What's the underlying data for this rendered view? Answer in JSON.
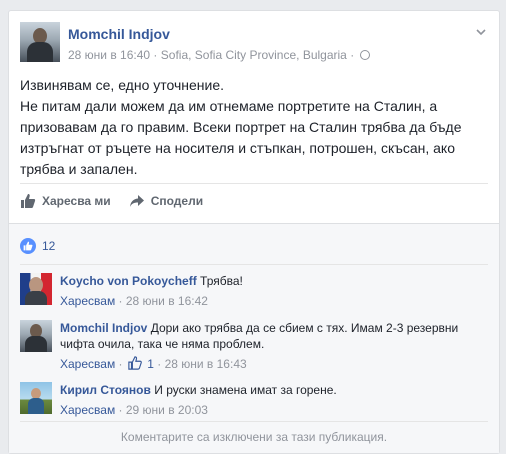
{
  "post": {
    "author": "Momchil Indjov",
    "date": "28 юни в 16:40",
    "location": "Sofia, Sofia City Province, Bulgaria",
    "text_lines": [
      "Извинявам се, едно уточнение.",
      "Не питам дали можем да им отнемаме портретите на Сталин, а",
      "призовавам да го правим. Всеки портрет на Сталин трябва да бъде",
      "изтръгнат от ръцете на носителя и стъпкан, потрошен, скъсан, ако",
      "трябва и запален."
    ]
  },
  "actions": {
    "like": "Харесва ми",
    "share": "Сподели"
  },
  "likes_count": "12",
  "comments": [
    {
      "author": "Koycho von Pokoycheff",
      "text": "Трябва!",
      "like_label": "Харесвам",
      "date": "28 юни в 16:42",
      "likes": ""
    },
    {
      "author": "Momchil Indjov",
      "text": "Дори ако трябва да се сбием с тях. Имам 2-3 резервни чифта очила, така че няма проблем.",
      "like_label": "Харесвам",
      "date": "28 юни в 16:43",
      "likes": "1"
    },
    {
      "author": "Кирил Стоянов",
      "text": "И руски знамена имат за горене.",
      "like_label": "Харесвам",
      "date": "29 юни в 20:03",
      "likes": ""
    }
  ],
  "closed_notice": "Коментарите са изключени за тази публикация.",
  "colors": {
    "link": "#365899",
    "meta": "#90949c",
    "like_blue": "#5890ff"
  },
  "icons": [
    "chevron-down-icon",
    "globe-icon",
    "like-icon",
    "share-icon"
  ]
}
